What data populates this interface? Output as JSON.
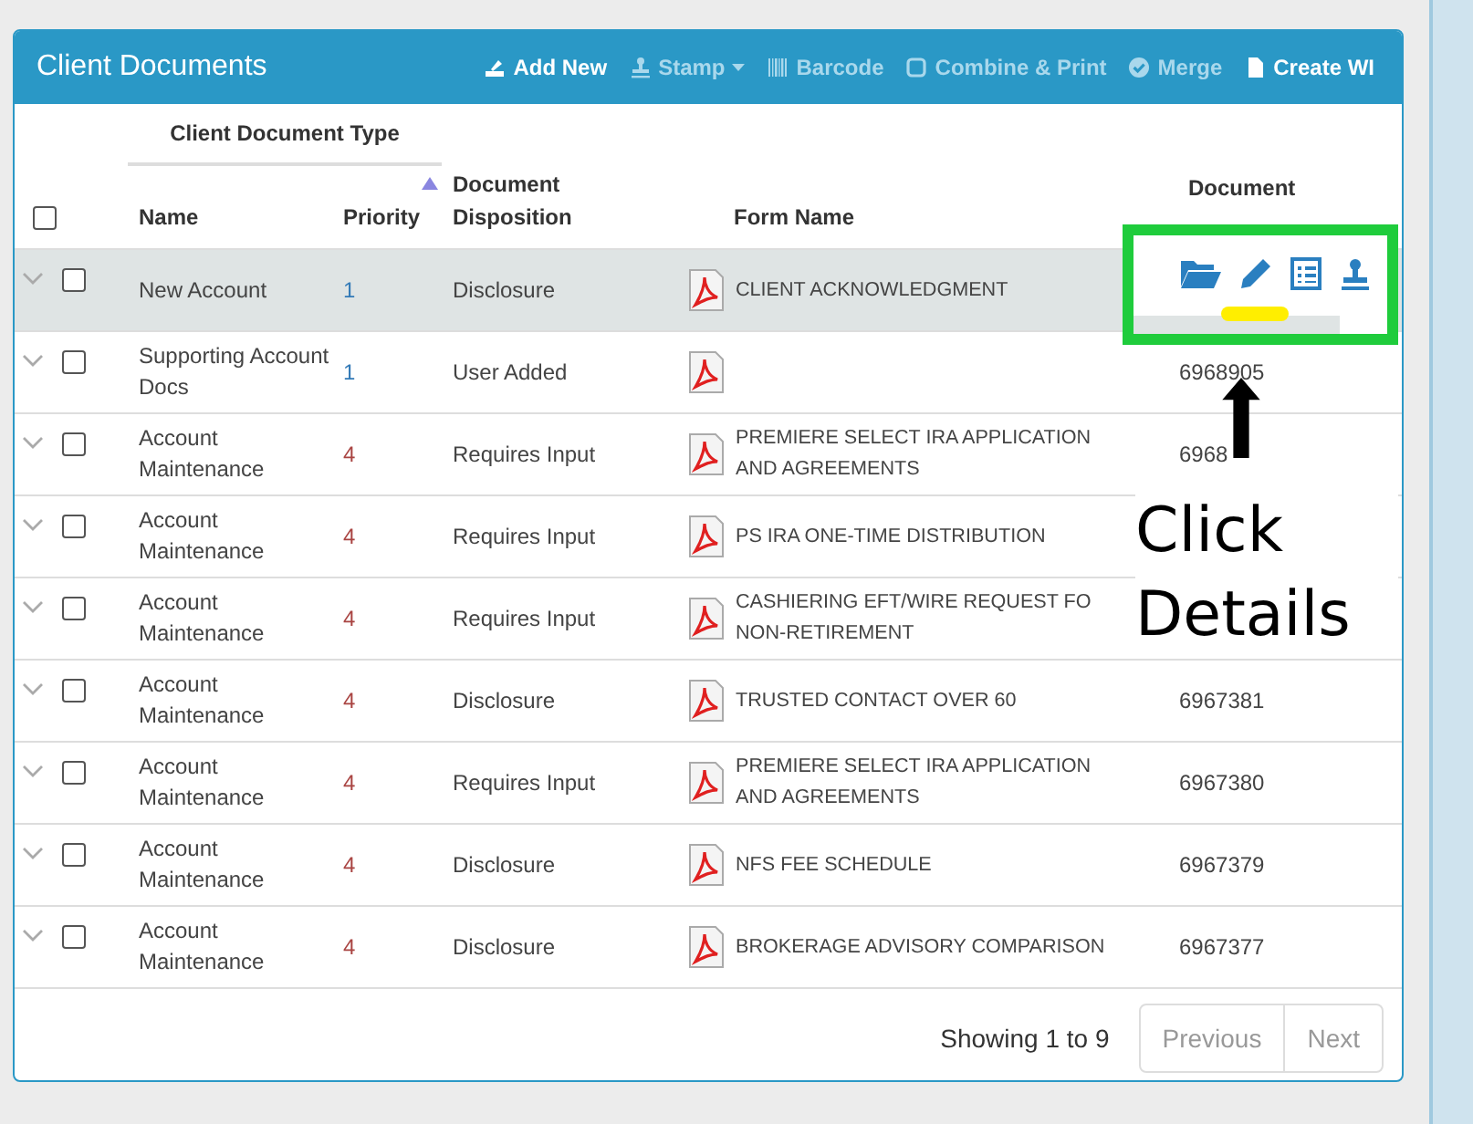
{
  "panel": {
    "title": "Client Documents",
    "actions": [
      {
        "kind": "upload",
        "label": "Add New",
        "disabled": false
      },
      {
        "kind": "stamp",
        "label": "Stamp",
        "disabled": true,
        "dropdown": true
      },
      {
        "kind": "barcode",
        "label": "Barcode",
        "disabled": true
      },
      {
        "kind": "square",
        "label": "Combine & Print",
        "disabled": true
      },
      {
        "kind": "check",
        "label": "Merge",
        "disabled": true
      },
      {
        "kind": "file",
        "label": "Create WI",
        "disabled": false
      }
    ]
  },
  "table": {
    "group_header": "Client Document Type",
    "select_all": {
      "checked": false
    },
    "columns": [
      {
        "label": "Name",
        "sorted": false
      },
      {
        "label": "Priority",
        "sorted": true
      },
      {
        "label": "Document Disposition",
        "sorted": false
      },
      {
        "label": "Form Name",
        "sorted": false
      },
      {
        "label": "Document",
        "sorted": false
      }
    ],
    "rows": [
      {
        "selected": true,
        "checked": false,
        "name": "New Account",
        "priority": "1",
        "color": "#337ab7",
        "disposition": "Disclosure",
        "form": "CLIENT ACKNOWLEDGMENT",
        "doc_id": ""
      },
      {
        "selected": false,
        "checked": false,
        "name": "Supporting Account Docs",
        "priority": "1",
        "color": "#337ab7",
        "disposition": "User Added",
        "form": "",
        "doc_id": "6968905"
      },
      {
        "selected": false,
        "checked": false,
        "name": "Account Maintenance",
        "priority": "4",
        "color": "#a94442",
        "disposition": "Requires Input",
        "form": "PREMIERE SELECT IRA APPLICATION AND AGREEMENTS",
        "doc_id": "6968"
      },
      {
        "selected": false,
        "checked": false,
        "name": "Account Maintenance",
        "priority": "4",
        "color": "#a94442",
        "disposition": "Requires Input",
        "form": "PS IRA ONE-TIME DISTRIBUTION",
        "doc_id": ""
      },
      {
        "selected": false,
        "checked": false,
        "name": "Account Maintenance",
        "priority": "4",
        "color": "#a94442",
        "disposition": "Requires Input",
        "form": "CASHIERING EFT/WIRE REQUEST FO NON-RETIREMENT",
        "doc_id": ""
      },
      {
        "selected": false,
        "checked": false,
        "name": "Account Maintenance",
        "priority": "4",
        "color": "#a94442",
        "disposition": "Disclosure",
        "form": "TRUSTED CONTACT OVER 60",
        "doc_id": "6967381"
      },
      {
        "selected": false,
        "checked": false,
        "name": "Account Maintenance",
        "priority": "4",
        "color": "#a94442",
        "disposition": "Requires Input",
        "form": "PREMIERE SELECT IRA APPLICATION AND AGREEMENTS",
        "doc_id": "6967380"
      },
      {
        "selected": false,
        "checked": false,
        "name": "Account Maintenance",
        "priority": "4",
        "color": "#a94442",
        "disposition": "Disclosure",
        "form": "NFS FEE SCHEDULE",
        "doc_id": "6967379"
      },
      {
        "selected": false,
        "checked": false,
        "name": "Account Maintenance",
        "priority": "4",
        "color": "#a94442",
        "disposition": "Disclosure",
        "form": "BROKERAGE ADVISORY COMPARISON",
        "doc_id": "6967377"
      }
    ]
  },
  "footer": {
    "info": "Showing 1 to 9",
    "pages": [
      {
        "label": "Previous",
        "disabled": true
      },
      {
        "label": "Next",
        "disabled": true
      }
    ]
  },
  "annotation": {
    "text": "Click Details"
  }
}
